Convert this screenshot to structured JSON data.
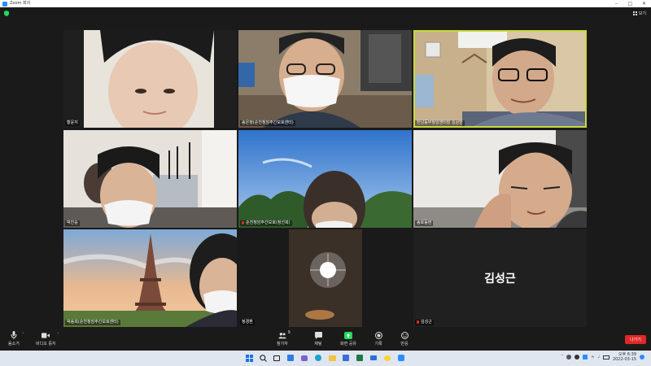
{
  "window": {
    "title": "Zoom 회의"
  },
  "meeting": {
    "view_label": "보기"
  },
  "participants": [
    {
      "name": "황윤지",
      "muted": false
    },
    {
      "name": "송은정(순천청암주간보호센터)",
      "muted": false
    },
    {
      "name": "전남동부청암센터장 김상만",
      "muted": false,
      "active": true
    },
    {
      "name": "박진숭",
      "muted": false
    },
    {
      "name": "순천청암주간보호(정선희)",
      "muted": true
    },
    {
      "name": "송호동현",
      "muted": false
    },
    {
      "name": "박송희(순천청암주간보호센터)",
      "muted": false
    },
    {
      "name": "정경환",
      "muted": false
    },
    {
      "name": "김성근",
      "muted": true,
      "display_name": "김성근"
    }
  ],
  "toolbar": {
    "mute_label": "음소거",
    "video_label": "비디오 중지",
    "participants_label": "참가자",
    "participants_count": "9",
    "chat_label": "채팅",
    "share_label": "화면 공유",
    "record_label": "기록",
    "reactions_label": "반응",
    "leave_label": "나가기"
  },
  "taskbar": {
    "time": "오후 6:39",
    "date": "2022-03-15"
  },
  "colors": {
    "accent": "#2d8cff",
    "share_green": "#23d959",
    "leave_red": "#e02828",
    "active_border": "#c9d93a"
  }
}
